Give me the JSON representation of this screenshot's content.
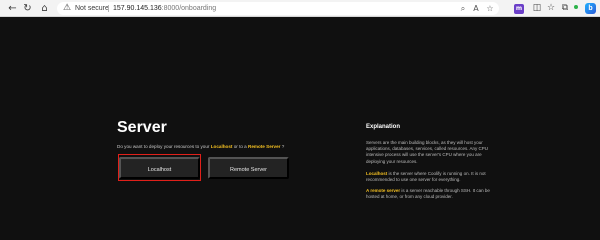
{
  "browser": {
    "security_label": "Not secure",
    "url_host": "157.90.145.136",
    "url_path": ":8000/onboarding",
    "icons": [
      "back-icon",
      "forward-icon",
      "reload-icon",
      "home-icon",
      "warning-icon",
      "zoom-icon",
      "read-aloud-icon",
      "favorite-icon",
      "extension-icon",
      "split-screen-icon",
      "favorites-bar-icon",
      "collections-icon",
      "profile-icon",
      "copilot-icon"
    ]
  },
  "main": {
    "title": "Server",
    "question_prefix": "Do you want to deploy your resources to your",
    "question_localhost": "Localhost",
    "question_middle": "or to a",
    "question_remote": "Remote Server",
    "question_suffix": "?",
    "options": {
      "localhost_label": "Localhost",
      "remote_label": "Remote Server"
    }
  },
  "explanation": {
    "title": "Explanation",
    "p1": "Servers are the main building blocks, as they will host your applications, databases, services, called resources. Any CPU intensive process will use the server's CPU where you are deploying your resources.",
    "p2_bold": "Localhost",
    "p2_rest": "is the server where Coolify is running on. It is not recommended to use one server for everything.",
    "p3_bold": "A remote server",
    "p3_rest": "is a server reachable through SSH. It can be hosted at home, or from any cloud provider."
  },
  "colors": {
    "background": "#101010",
    "accent_yellow": "#f4c022",
    "button_bg": "#232323",
    "highlight_red": "#e0201a"
  }
}
